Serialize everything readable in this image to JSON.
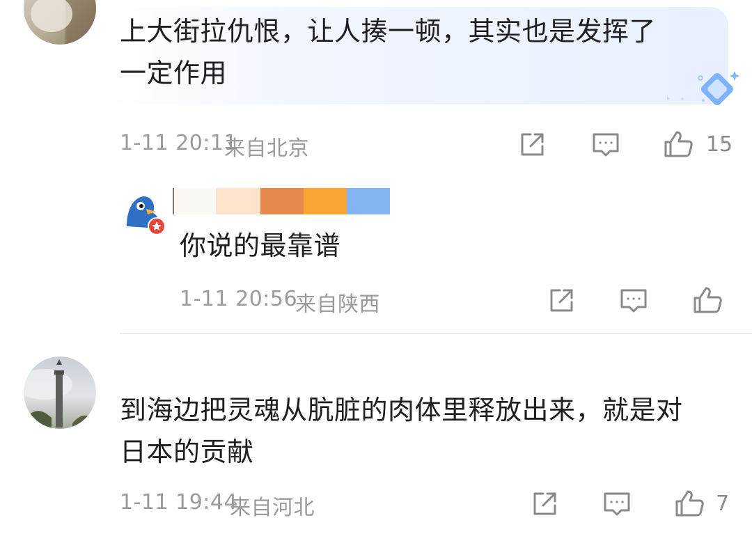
{
  "comments": [
    {
      "text_line1": "上大街拉仇恨，让人揍一顿，其实也是发挥了",
      "text_line2": "一定作用",
      "time": "1-11 20:11",
      "location": "来自北京",
      "likes": "15"
    },
    {
      "text": "你说的最靠谱",
      "time": "1-11 20:56",
      "location": "来自陕西"
    },
    {
      "text_line1": "到海边把灵魂从肮脏的肉体里释放出来，就是对",
      "text_line2": "日本的贡献",
      "time": "1-11 19:44",
      "location": "来自河北",
      "likes": "7"
    }
  ],
  "colors": {
    "highlight": "#eef4ff",
    "meta": "#9a9a9a",
    "icon": "#8a8a8a",
    "badge": "#e8453c"
  },
  "icons": [
    "share-icon",
    "comment-icon",
    "like-icon",
    "diamond-sparkle-icon"
  ]
}
